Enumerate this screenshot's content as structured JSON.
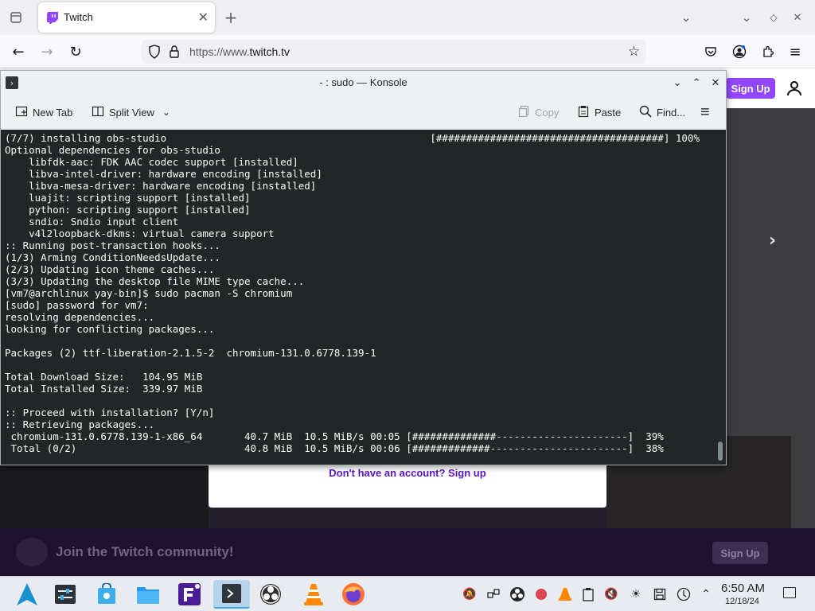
{
  "browser": {
    "tab_title": "Twitch",
    "url_scheme": "https://www.",
    "url_host": "twitch.tv"
  },
  "twitch": {
    "signup_top": "Sign Up",
    "signup_link": "Don't have an account? Sign up",
    "join_text": "Join the Twitch community!",
    "signup_bottom": "Sign Up"
  },
  "konsole": {
    "title": "- : sudo — Konsole",
    "toolbar": {
      "new_tab": "New Tab",
      "split_view": "Split View",
      "copy": "Copy",
      "paste": "Paste",
      "find": "Find..."
    },
    "terminal_output": "(7/7) installing obs-studio                                            [######################################] 100%\nOptional dependencies for obs-studio\n    libfdk-aac: FDK AAC codec support [installed]\n    libva-intel-driver: hardware encoding [installed]\n    libva-mesa-driver: hardware encoding [installed]\n    luajit: scripting support [installed]\n    python: scripting support [installed]\n    sndio: Sndio input client\n    v4l2loopback-dkms: virtual camera support\n:: Running post-transaction hooks...\n(1/3) Arming ConditionNeedsUpdate...\n(2/3) Updating icon theme caches...\n(3/3) Updating the desktop file MIME type cache...\n[vm7@archlinux yay-bin]$ sudo pacman -S chromium\n[sudo] password for vm7:\nresolving dependencies...\nlooking for conflicting packages...\n\nPackages (2) ttf-liberation-2.1.5-2  chromium-131.0.6778.139-1\n\nTotal Download Size:   104.95 MiB\nTotal Installed Size:  339.97 MiB\n\n:: Proceed with installation? [Y/n]\n:: Retrieving packages...\n chromium-131.0.6778.139-1-x86_64       40.7 MiB  10.5 MiB/s 00:05 [##############----------------------]  39%\n Total (0/2)                            40.8 MiB  10.5 MiB/s 00:06 [#############-----------------------]  38%"
  },
  "taskbar": {
    "clock_time": "6:50 AM",
    "clock_date": "12/18/24"
  },
  "colors": {
    "twitch_purple": "#9147ff",
    "terminal_bg": "#232627",
    "kde_accent": "#3daee9"
  }
}
